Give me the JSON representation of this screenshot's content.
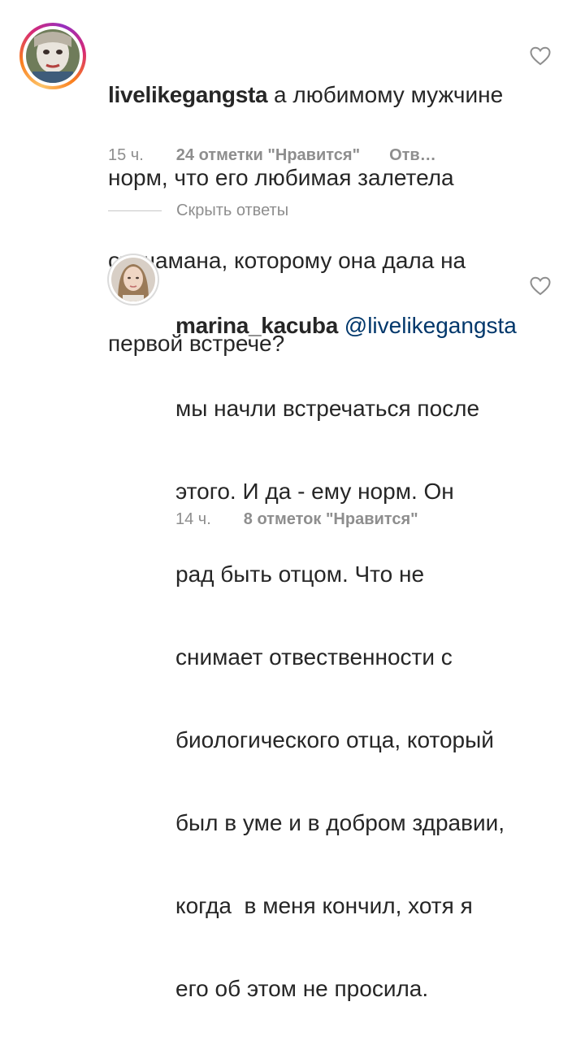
{
  "comments": [
    {
      "username": "livelikegangsta",
      "text_lines": [
        "а любимому мужчине",
        "норм, что его любимая залетела",
        "от шамана, которому она дала на",
        "первой встрече?"
      ],
      "time": "15 ч.",
      "likes": "24 отметки \"Нравится\"",
      "reply": "Отв…",
      "like_icon": "heart-outline-icon",
      "avatar_icon": "avatar-mime-face"
    },
    {
      "username": "marina_kacuba",
      "mention": "@livelikegangsta",
      "text_lines": [
        "мы начли встречаться после",
        "этого. И да - ему норм. Он",
        "рад быть отцом. Что не",
        "снимает отвественности с",
        "биологического отца, который",
        "был в уме и в добром здравии,",
        "когда  в меня кончил, хотя я",
        "его об этом не просила."
      ],
      "time": "14 ч.",
      "likes": "8 отметок \"Нравится\"",
      "like_icon": "heart-outline-icon",
      "avatar_icon": "avatar-woman-portrait"
    }
  ],
  "hide_replies": "Скрыть ответы"
}
